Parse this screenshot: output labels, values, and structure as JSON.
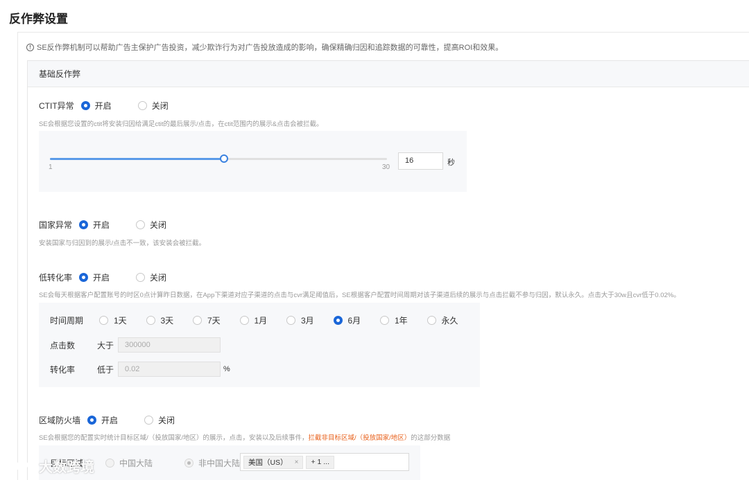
{
  "page_title": "反作弊设置",
  "notice": "SE反作弊机制可以帮助广告主保护广告投资，减少欺诈行为对广告投放造成的影响，确保精确归因和追踪数据的可靠性，提高ROI和效果。",
  "card_title": "基础反作弊",
  "ctit": {
    "label": "CTIT异常",
    "on_label": "开启",
    "off_label": "关闭",
    "enabled": true,
    "desc": "SE会根据您设置的ctit将安装归因给满足ctit的最后展示/点击，在ctit范围内的展示&点击会被拦截。",
    "slider_min": "1",
    "slider_max": "30",
    "value": "16",
    "unit": "秒"
  },
  "country": {
    "label": "国家异常",
    "on_label": "开启",
    "off_label": "关闭",
    "enabled": true,
    "desc": "安装国家与归因到的展示/点击不一致，该安装会被拦截。"
  },
  "low_cvr": {
    "label": "低转化率",
    "on_label": "开启",
    "off_label": "关闭",
    "enabled": true,
    "desc": "SE会每天根据客户配置账号的时区0点计算昨日数据，在App下渠道对应子渠道的点击与cvr满足阈值后，SE根据客户配置时间周期对该子渠道后续的展示与点击拦截不参与归因，默认永久。点击大于30w且cvr低于0.02%。",
    "period_label": "时间周期",
    "periods": [
      "1天",
      "3天",
      "7天",
      "1月",
      "3月",
      "6月",
      "1年",
      "永久"
    ],
    "selected_period": "6月",
    "clicks_label": "点击数",
    "clicks_op": "大于",
    "clicks_placeholder": "300000",
    "cvr_label": "转化率",
    "cvr_op": "低于",
    "cvr_placeholder": "0.02",
    "cvr_unit": "%"
  },
  "region_firewall": {
    "label": "区域防火墙",
    "on_label": "开启",
    "off_label": "关闭",
    "enabled": true,
    "desc_prefix": "SE会根据您的配置实时统计目标区域/（投放国家/地区）的展示，点击，安装以及后续事件，",
    "desc_warn": "拦截非目标区域/（投放国家/地区）",
    "desc_suffix": "的这部分数据",
    "target_label": "目标区域",
    "opt_mainland": "中国大陆",
    "opt_non_mainland": "非中国大陆",
    "tag_us": "美国（US）",
    "tag_more": "+ 1 ..."
  },
  "watermark_text": "大数跨境",
  "colors": {
    "primary": "#1a66d8",
    "slider": "#5a9be8",
    "warn": "#e8611c"
  }
}
